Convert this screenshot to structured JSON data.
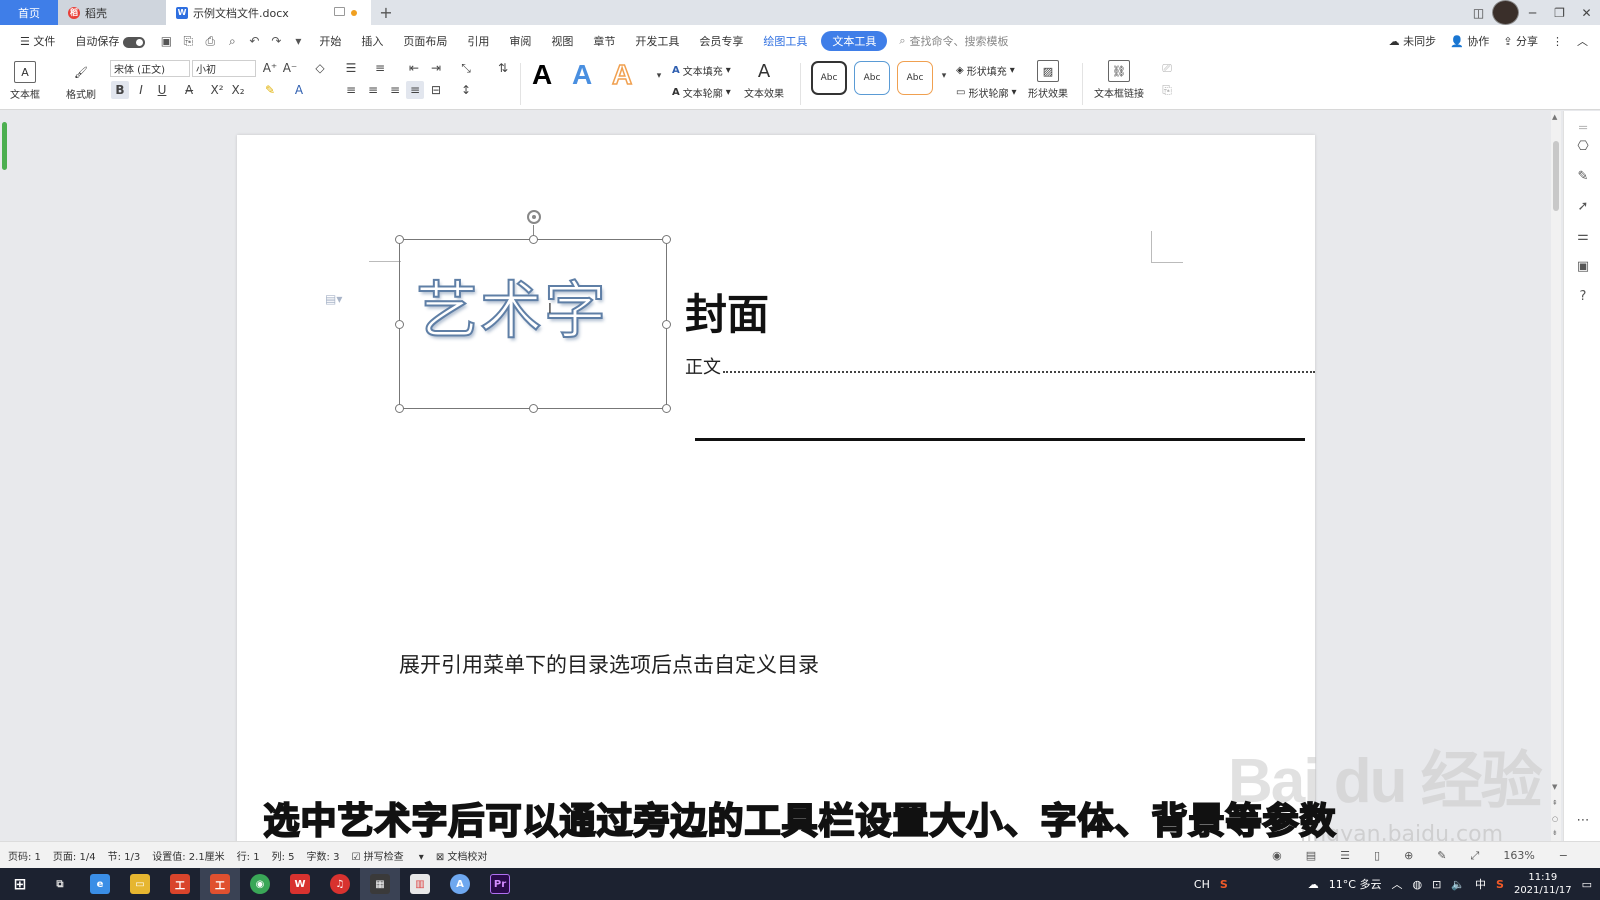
{
  "titlebar": {
    "tabs": [
      {
        "label": "首页"
      },
      {
        "label": "稻壳"
      },
      {
        "label": "示例文档文件.docx"
      }
    ],
    "add_tab": "+"
  },
  "menu": {
    "file": "文件",
    "autosave": "自动保存",
    "items": [
      "开始",
      "插入",
      "页面布局",
      "引用",
      "审阅",
      "视图",
      "章节",
      "开发工具",
      "会员专享"
    ],
    "drawing_tools": "绘图工具",
    "text_tools": "文本工具",
    "search_placeholder": "查找命令、搜索模板",
    "sync": "未同步",
    "collab": "协作",
    "share": "分享"
  },
  "ribbon": {
    "text_box": "文本框",
    "format_painter": "格式刷",
    "font_name": "宋体 (正文)",
    "font_size": "小初",
    "text_fill": "文本填充",
    "text_outline": "文本轮廓",
    "text_effect": "文本效果",
    "style_samples": [
      "Abc",
      "Abc",
      "Abc"
    ],
    "shape_fill": "形状填充",
    "shape_outline": "形状轮廓",
    "shape_effect": "形状效果",
    "text_box_link": "文本框链接",
    "wordart_colors": [
      "#000000",
      "#4a8fe0",
      "#f0a050"
    ]
  },
  "document": {
    "wordart": "艺术字",
    "cover_title": "封面",
    "toc_entry": "正文",
    "instruction": "展开引用菜单下的目录选项后点击自定义目录"
  },
  "subtitle": "选中艺术字后可以通过旁边的工具栏设置大小、字体、背景等参数",
  "watermark": {
    "brand": "Bai du 经验",
    "url": "jingyan.baidu.com"
  },
  "statusbar": {
    "page": "页码: 1",
    "pages": "页面: 1/4",
    "section": "节: 1/3",
    "setting": "设置值: 2.1厘米",
    "row": "行: 1",
    "col": "列: 5",
    "words": "字数: 3",
    "spellcheck": "拼写检查",
    "proof": "文档校对",
    "zoom": "163%"
  },
  "taskbar": {
    "weather": "11°C 多云",
    "ime": "中",
    "time": "11:19",
    "date": "2021/11/17",
    "lang": "CH"
  }
}
